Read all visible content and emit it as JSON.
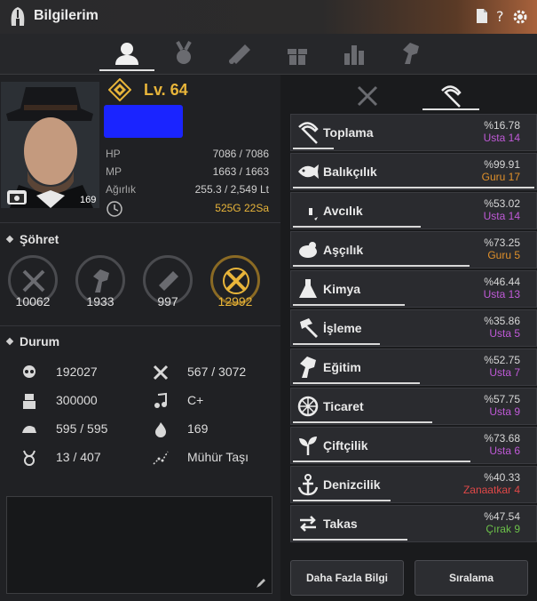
{
  "window": {
    "title": "Bilgilerim"
  },
  "tabs": [
    {
      "name": "character",
      "icon": "person-icon",
      "active": true
    },
    {
      "name": "medal",
      "icon": "medal-icon",
      "active": false
    },
    {
      "name": "scroll",
      "icon": "scroll-icon",
      "active": false
    },
    {
      "name": "gift",
      "icon": "gift-icon",
      "active": false
    },
    {
      "name": "stats",
      "icon": "bar-chart-icon",
      "active": false
    },
    {
      "name": "mount",
      "icon": "horse-icon",
      "active": false
    }
  ],
  "character": {
    "level": "Lv. 64",
    "portrait_level": "169",
    "stats": [
      {
        "label": "HP",
        "value": "7086 / 7086"
      },
      {
        "label": "MP",
        "value": "1663 / 1663"
      },
      {
        "label": "Ağırlık",
        "value": "255.3 / 2,549 Lt"
      }
    ],
    "money": "525G 22Sa"
  },
  "fame": {
    "title": "Şöhret",
    "items": [
      {
        "icon": "swords-icon",
        "value": "10062",
        "highlight": false
      },
      {
        "icon": "horse-head-icon",
        "value": "1933",
        "highlight": false
      },
      {
        "icon": "scroll-icon",
        "value": "997",
        "highlight": false
      },
      {
        "icon": "crossed-swords-gold-icon",
        "value": "12992",
        "highlight": true
      }
    ]
  },
  "status": {
    "title": "Durum",
    "items": [
      {
        "icon": "skull-icon",
        "value": "192027"
      },
      {
        "icon": "tools-icon",
        "value": "567 / 3072"
      },
      {
        "icon": "guard-icon",
        "value": "300000"
      },
      {
        "icon": "music-note-icon",
        "value": "C+"
      },
      {
        "icon": "arm-icon",
        "value": "595 / 595"
      },
      {
        "icon": "flame-icon",
        "value": "169"
      },
      {
        "icon": "horn-icon",
        "value": "13 / 407"
      },
      {
        "icon": "constellation-icon",
        "value": "Mühür Taşı"
      }
    ]
  },
  "life_skills": [
    {
      "name": "Toplama",
      "icon": "sickle-icon",
      "percent": "%16.78",
      "rank": "Usta 14",
      "rank_color": "#c05ad8",
      "progress": 0.1678
    },
    {
      "name": "Balıkçılık",
      "icon": "fish-icon",
      "percent": "%99.91",
      "rank": "Guru 17",
      "rank_color": "#e0902a",
      "progress": 0.9991
    },
    {
      "name": "Avcılık",
      "icon": "rifle-icon",
      "percent": "%53.02",
      "rank": "Usta 14",
      "rank_color": "#c05ad8",
      "progress": 0.5302
    },
    {
      "name": "Aşçılık",
      "icon": "cooking-icon",
      "percent": "%73.25",
      "rank": "Guru 5",
      "rank_color": "#e0902a",
      "progress": 0.7325
    },
    {
      "name": "Kimya",
      "icon": "flask-icon",
      "percent": "%46.44",
      "rank": "Usta 13",
      "rank_color": "#c05ad8",
      "progress": 0.4644
    },
    {
      "name": "İşleme",
      "icon": "hammer-icon",
      "percent": "%35.86",
      "rank": "Usta 5",
      "rank_color": "#c05ad8",
      "progress": 0.3586
    },
    {
      "name": "Eğitim",
      "icon": "horse-head-icon",
      "percent": "%52.75",
      "rank": "Usta 7",
      "rank_color": "#c05ad8",
      "progress": 0.5275
    },
    {
      "name": "Ticaret",
      "icon": "wheel-icon",
      "percent": "%57.75",
      "rank": "Usta 9",
      "rank_color": "#c05ad8",
      "progress": 0.5775
    },
    {
      "name": "Çiftçilik",
      "icon": "sprout-icon",
      "percent": "%73.68",
      "rank": "Usta 6",
      "rank_color": "#c05ad8",
      "progress": 0.7368
    },
    {
      "name": "Denizcilik",
      "icon": "anchor-icon",
      "percent": "%40.33",
      "rank": "Zanaatkar 4",
      "rank_color": "#e04848",
      "progress": 0.4033
    },
    {
      "name": "Takas",
      "icon": "exchange-icon",
      "percent": "%47.54",
      "rank": "Çırak 9",
      "rank_color": "#6cc04a",
      "progress": 0.4754
    }
  ],
  "buttons": {
    "more_info": "Daha Fazla Bilgi",
    "ranking": "Sıralama"
  }
}
